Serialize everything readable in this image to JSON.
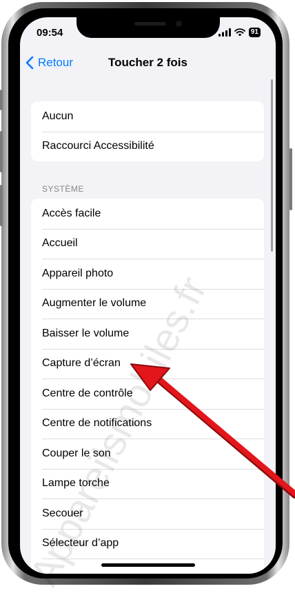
{
  "status_bar": {
    "time": "09:54",
    "battery": "91"
  },
  "nav": {
    "back_label": "Retour",
    "title": "Toucher 2 fois"
  },
  "groups": {
    "top": [
      "Aucun",
      "Raccourci Accessibilité"
    ],
    "system_header": "SYSTÈME",
    "system": [
      "Accès facile",
      "Accueil",
      "Appareil photo",
      "Augmenter le volume",
      "Baisser le volume",
      "Capture d’écran",
      "Centre de contrôle",
      "Centre de notifications",
      "Couper le son",
      "Lampe torche",
      "Secouer",
      "Sélecteur d’app"
    ]
  },
  "watermark": "Appareilsmobiles.fr",
  "colors": {
    "accent": "#007aff",
    "arrow": "#e3161b",
    "background": "#f2f2f7"
  }
}
